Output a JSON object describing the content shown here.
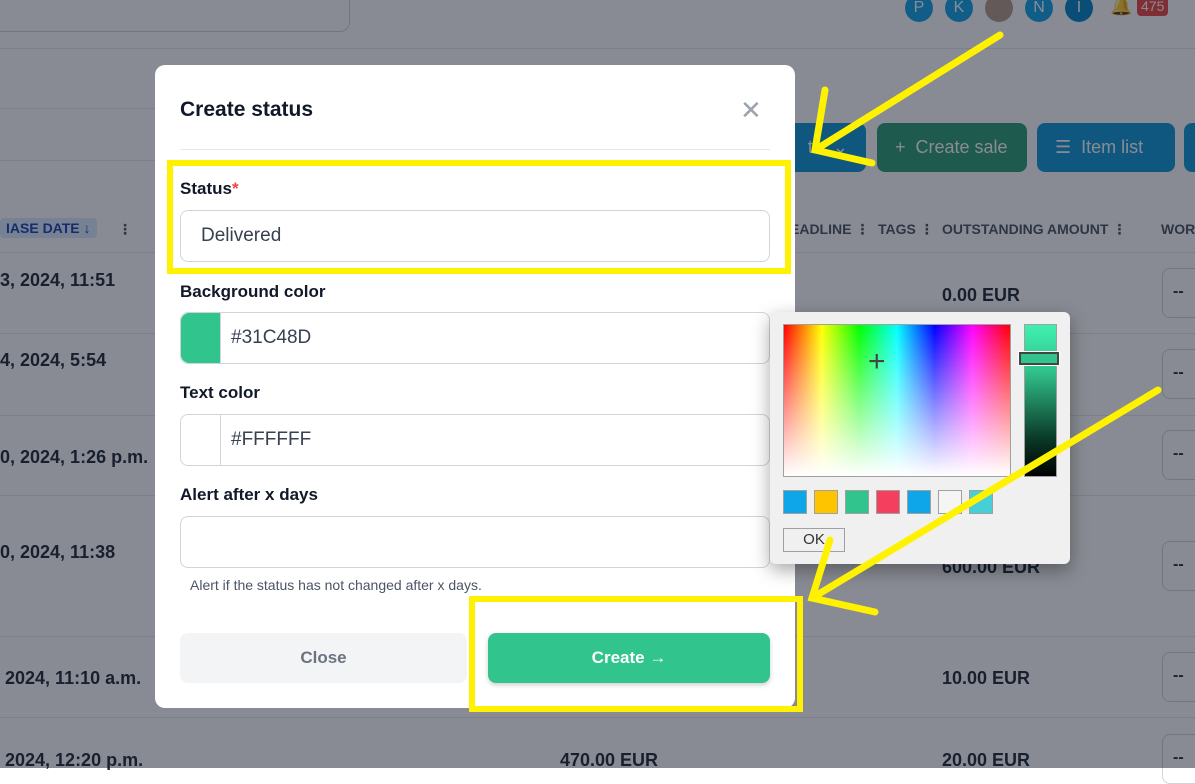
{
  "header": {
    "avatars": [
      "P",
      "K",
      "",
      "N",
      "I"
    ],
    "notification_count": "475"
  },
  "toolbar": {
    "create_sale": "Create sale",
    "item_list": "Item list",
    "partial_button": "te"
  },
  "table": {
    "columns": [
      "IASE DATE",
      "EADLINE",
      "TAGS",
      "OUTSTANDING AMOUNT",
      "WOR"
    ],
    "rows": [
      {
        "date": "3, 2024, 11:51",
        "amount": "",
        "outstanding": "0.00 EUR",
        "work": "--"
      },
      {
        "date": "4, 2024, 5:54",
        "amount": "",
        "outstanding": "",
        "work": "--"
      },
      {
        "date": "0, 2024, 1:26 p.m.",
        "amount": "",
        "outstanding": "",
        "work": "--"
      },
      {
        "date": "0, 2024, 11:38",
        "amount": "",
        "outstanding": "600.00 EUR",
        "work": "--"
      },
      {
        "date": "2024, 11:10 a.m.",
        "amount": "",
        "outstanding": "10.00 EUR",
        "work": "--"
      },
      {
        "date": "2024, 12:20 p.m.",
        "amount": "470.00 EUR",
        "outstanding": "20.00 EUR",
        "work": "--"
      }
    ]
  },
  "modal": {
    "title": "Create status",
    "status_label": "Status",
    "required_mark": "*",
    "status_value": "Delivered",
    "bg_label": "Background color",
    "bg_value": "#31C48D",
    "text_label": "Text color",
    "text_value": "#FFFFFF",
    "alert_label": "Alert after x days",
    "alert_value": "",
    "alert_help": "Alert if the status has not changed after x days.",
    "close_button": "Close",
    "create_button": "Create →"
  },
  "color_picker": {
    "ok": "OK",
    "swatches": [
      "#0EA5E9",
      "#FFC400",
      "#31C48D",
      "#F43F5E",
      "#0EA5E9",
      "#F5F5F5",
      "#45CFD6"
    ]
  },
  "colors": {
    "accent_green": "#31C48D",
    "highlight": "#FFF200",
    "primary_blue": "#0F97D9"
  }
}
